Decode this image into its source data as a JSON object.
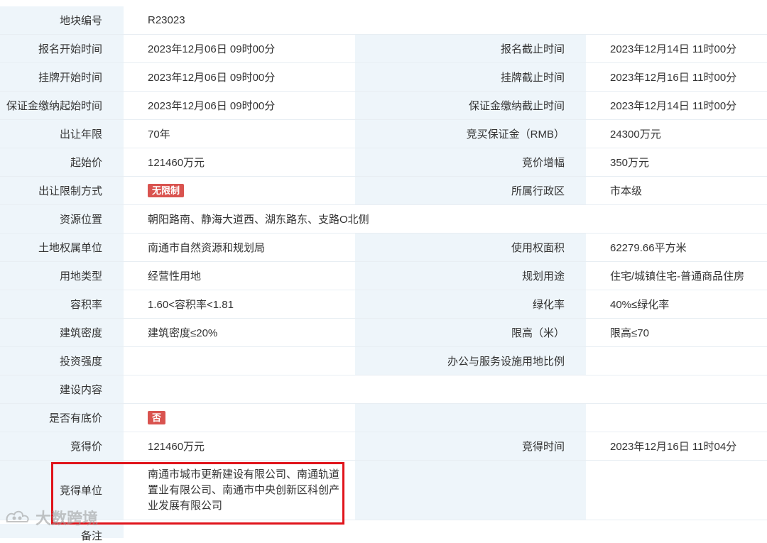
{
  "rows": [
    {
      "type": "wide",
      "label": "地块编号",
      "value": "R23023"
    },
    {
      "type": "pair",
      "label": "报名开始时间",
      "value": "2023年12月06日 09时00分",
      "label2": "报名截止时间",
      "value2": "2023年12月14日 11时00分"
    },
    {
      "type": "pair",
      "label": "挂牌开始时间",
      "value": "2023年12月06日 09时00分",
      "label2": "挂牌截止时间",
      "value2": "2023年12月16日 11时00分"
    },
    {
      "type": "pair",
      "label": "保证金缴纳起始时间",
      "value": "2023年12月06日 09时00分",
      "label2": "保证金缴纳截止时间",
      "value2": "2023年12月14日 11时00分"
    },
    {
      "type": "pair",
      "label": "出让年限",
      "value": "70年",
      "label2": "竞买保证金（RMB）",
      "value2": "24300万元"
    },
    {
      "type": "pair",
      "label": "起始价",
      "value": "121460万元",
      "label2": "竞价增幅",
      "value2": "350万元"
    },
    {
      "type": "pair",
      "label": "出让限制方式",
      "badge": "无限制",
      "label2": "所属行政区",
      "value2": "市本级"
    },
    {
      "type": "wide",
      "label": "资源位置",
      "value": "朝阳路南、静海大道西、湖东路东、支路O北侧"
    },
    {
      "type": "pair",
      "label": "土地权属单位",
      "value": "南通市自然资源和规划局",
      "label2": "使用权面积",
      "value2": "62279.66平方米"
    },
    {
      "type": "pair",
      "label": "用地类型",
      "value": "经营性用地",
      "label2": "规划用途",
      "value2": "住宅/城镇住宅-普通商品住房"
    },
    {
      "type": "pair",
      "label": "容积率",
      "value": "1.60<容积率<1.81",
      "label2": "绿化率",
      "value2": "40%≤绿化率"
    },
    {
      "type": "pair",
      "label": "建筑密度",
      "value": "建筑密度≤20%",
      "label2": "限高（米）",
      "value2": "限高≤70"
    },
    {
      "type": "pair",
      "label": "投资强度",
      "value": "",
      "label2": "办公与服务设施用地比例",
      "value2": ""
    },
    {
      "type": "wide",
      "label": "建设内容",
      "value": ""
    },
    {
      "type": "pair",
      "label": "是否有底价",
      "badge": "否",
      "label2": "",
      "value2": ""
    },
    {
      "type": "pair",
      "label": "竞得价",
      "value": "121460万元",
      "label2": "竞得时间",
      "value2": "2023年12月16日 11时04分"
    },
    {
      "type": "tall",
      "label": "竞得单位",
      "value": "南通市城市更新建设有限公司、南通轨道置业有限公司、南通市中央创新区科创产业发展有限公司",
      "label2": "",
      "value2": ""
    }
  ],
  "partial_label": "备注",
  "watermark": "大数跨境",
  "colors": {
    "label_bg": "#eef5fa",
    "badge": "#d9534f",
    "highlight": "#e0141b"
  }
}
